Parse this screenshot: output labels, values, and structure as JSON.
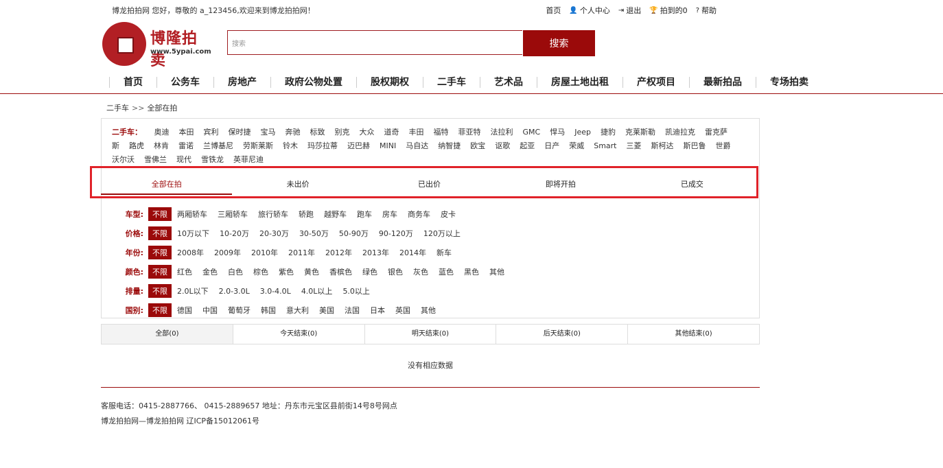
{
  "topbar": {
    "welcome": "博龙拍拍网 您好，尊敬的 a_123456,欢迎来到博龙拍拍网！",
    "links": [
      {
        "icon": "none",
        "label": "首页"
      },
      {
        "icon": "user-icon",
        "label": "个人中心"
      },
      {
        "icon": "logout-icon",
        "label": "退出"
      },
      {
        "icon": "trophy-icon",
        "label": "拍到的0"
      },
      {
        "icon": "help-icon",
        "label": "帮助"
      }
    ]
  },
  "logo": {
    "brand": "博隆拍卖",
    "url": "www.5ypai.com"
  },
  "search": {
    "placeholder": "搜索",
    "button": "搜索"
  },
  "nav": [
    "首页",
    "公务车",
    "房地产",
    "政府公物处置",
    "股权期权",
    "二手车",
    "艺术品",
    "房屋土地出租",
    "产权项目",
    "最新拍品",
    "专场拍卖"
  ],
  "breadcrumb": {
    "parent": "二手车",
    "sep": ">>",
    "current": "全部在拍"
  },
  "brands": {
    "label": "二手车：",
    "items": [
      "奥迪",
      "本田",
      "宾利",
      "保时捷",
      "宝马",
      "奔驰",
      "标致",
      "别克",
      "大众",
      "道奇",
      "丰田",
      "福特",
      "菲亚特",
      "法拉利",
      "GMC",
      "悍马",
      "Jeep",
      "捷豹",
      "克莱斯勒",
      "凯迪拉克",
      "雷克萨斯",
      "路虎",
      "林肯",
      "雷诺",
      "兰博基尼",
      "劳斯莱斯",
      "铃木",
      "玛莎拉蒂",
      "迈巴赫",
      "MINI",
      "马自达",
      "纳智捷",
      "欧宝",
      "讴歌",
      "起亚",
      "日产",
      "荣威",
      "Smart",
      "三菱",
      "斯柯达",
      "斯巴鲁",
      "世爵",
      "沃尔沃",
      "雪佛兰",
      "现代",
      "雪铁龙",
      "英菲尼迪"
    ]
  },
  "status_tabs": [
    "全部在拍",
    "未出价",
    "已出价",
    "即将开拍",
    "已成交"
  ],
  "filters": [
    {
      "label": "车型:",
      "options": [
        "不限",
        "两厢轿车",
        "三厢轿车",
        "旅行轿车",
        "轿跑",
        "越野车",
        "跑车",
        "房车",
        "商务车",
        "皮卡"
      ]
    },
    {
      "label": "价格:",
      "options": [
        "不限",
        "10万以下",
        "10-20万",
        "20-30万",
        "30-50万",
        "50-90万",
        "90-120万",
        "120万以上"
      ]
    },
    {
      "label": "年份:",
      "options": [
        "不限",
        "2008年",
        "2009年",
        "2010年",
        "2011年",
        "2012年",
        "2013年",
        "2014年",
        "新车"
      ]
    },
    {
      "label": "颜色:",
      "options": [
        "不限",
        "红色",
        "金色",
        "白色",
        "棕色",
        "紫色",
        "黄色",
        "香槟色",
        "绿色",
        "银色",
        "灰色",
        "蓝色",
        "黑色",
        "其他"
      ]
    },
    {
      "label": "排量:",
      "options": [
        "不限",
        "2.0L以下",
        "2.0-3.0L",
        "3.0-4.0L",
        "4.0L以上",
        "5.0以上"
      ]
    },
    {
      "label": "国别:",
      "options": [
        "不限",
        "德国",
        "中国",
        "葡萄牙",
        "韩国",
        "意大利",
        "美国",
        "法国",
        "日本",
        "英国",
        "其他"
      ]
    }
  ],
  "time_tabs": [
    "全部(0)",
    "今天结束(0)",
    "明天结束(0)",
    "后天结束(0)",
    "其他结束(0)"
  ],
  "no_data": "没有相应数据",
  "footer": {
    "line1": "客服电话：0415-2887766、 0415-2889657   地址：丹东市元宝区县前街14号8号网点",
    "line2": "博龙拍拍网—博龙拍拍网     辽ICP备15012061号"
  },
  "colors": {
    "accent": "#9b0a0a",
    "highlight_box": "#e02229"
  }
}
